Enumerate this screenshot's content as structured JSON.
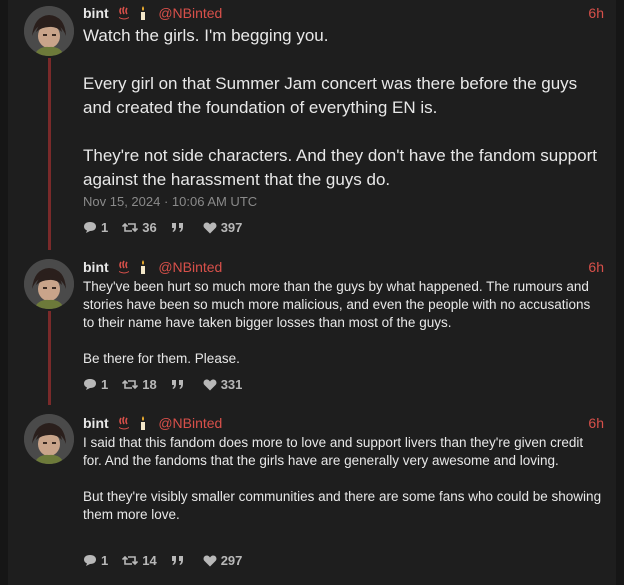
{
  "tweets": [
    {
      "name": "bint",
      "handle": "@NBinted",
      "time": "6h",
      "paragraphs": [
        "Watch the girls. I'm begging you.",
        "Every girl on that Summer Jam concert was there before the guys and created the foundation of everything EN is.",
        "They're not side characters. And they don't have the fandom support against the harassment that the guys do."
      ],
      "date": "Nov 15, 2024 · 10:06 AM UTC",
      "replies": "1",
      "retweets": "36",
      "quotes": "",
      "likes": "397"
    },
    {
      "name": "bint",
      "handle": "@NBinted",
      "time": "6h",
      "paragraphs": [
        "They've been hurt so much more than the guys by what happened. The rumours and stories have been so much more malicious, and even the people with no accusations to their name have taken bigger losses than most of the guys.",
        "Be there for them. Please."
      ],
      "replies": "1",
      "retweets": "18",
      "quotes": "",
      "likes": "331"
    },
    {
      "name": "bint",
      "handle": "@NBinted",
      "time": "6h",
      "paragraphs": [
        "I said that this fandom does more to love and support livers than they're given credit for. And the fandoms that the girls have are generally very awesome and loving.",
        "But they're visibly smaller communities and there are some fans who could be showing them more love."
      ],
      "replies": "1",
      "retweets": "14",
      "quotes": "",
      "likes": "297"
    }
  ],
  "icons": {
    "badge_1": "hot-springs-icon",
    "badge_2": "candle-icon",
    "reply": "comment-icon",
    "retweet": "retweet-icon",
    "quote": "quote-icon",
    "like": "heart-icon"
  },
  "colors": {
    "accent": "#d8504a",
    "thread_line": "#7a2a2a",
    "background": "#1e1e1e"
  }
}
